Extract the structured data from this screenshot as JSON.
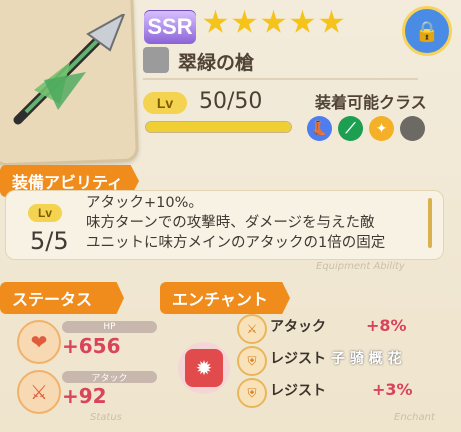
{
  "header": {
    "rarity": "SSR",
    "weapon_name": "翠緑の槍",
    "level_label": "Lv",
    "level_value": "50/50",
    "level_progress": 1.0
  },
  "classes": {
    "title": "装着可能クラス",
    "icons": [
      "boot-icon",
      "spear-icon",
      "wing-icon",
      "gray-icon"
    ]
  },
  "equipment_ability": {
    "section_title": "装備アビリティ",
    "level_label": "Lv",
    "level_value": "5/5",
    "lines": [
      "アタック+10%。",
      "味方ターンでの攻撃時、ダメージを与えた敵",
      "ユニットに味方メインのアタックの1倍の固定"
    ],
    "watermark": "Equipment Ability"
  },
  "status": {
    "section_title": "ステータス",
    "items": [
      {
        "name": "HP",
        "value": "+656",
        "icon": "heart-icon"
      },
      {
        "name": "アタック",
        "value": "+92",
        "icon": "sword-icon"
      }
    ],
    "watermark": "Status"
  },
  "enchant": {
    "section_title": "エンチャント",
    "items": [
      {
        "name": "アタック",
        "value": "+8%",
        "icon": "sword-icon"
      },
      {
        "name": "レジスト",
        "value": "",
        "icon": "shield-icon"
      },
      {
        "name": "レジスト",
        "value": "+3%",
        "icon": "shield-icon"
      }
    ],
    "overlay_text": "子 骑 概 花",
    "watermark": "Enchant"
  },
  "colors": {
    "accent": "#ef8c1c",
    "red_value": "#d9445b",
    "gold": "#f3d34f",
    "lock_blue": "#4a8be6"
  }
}
